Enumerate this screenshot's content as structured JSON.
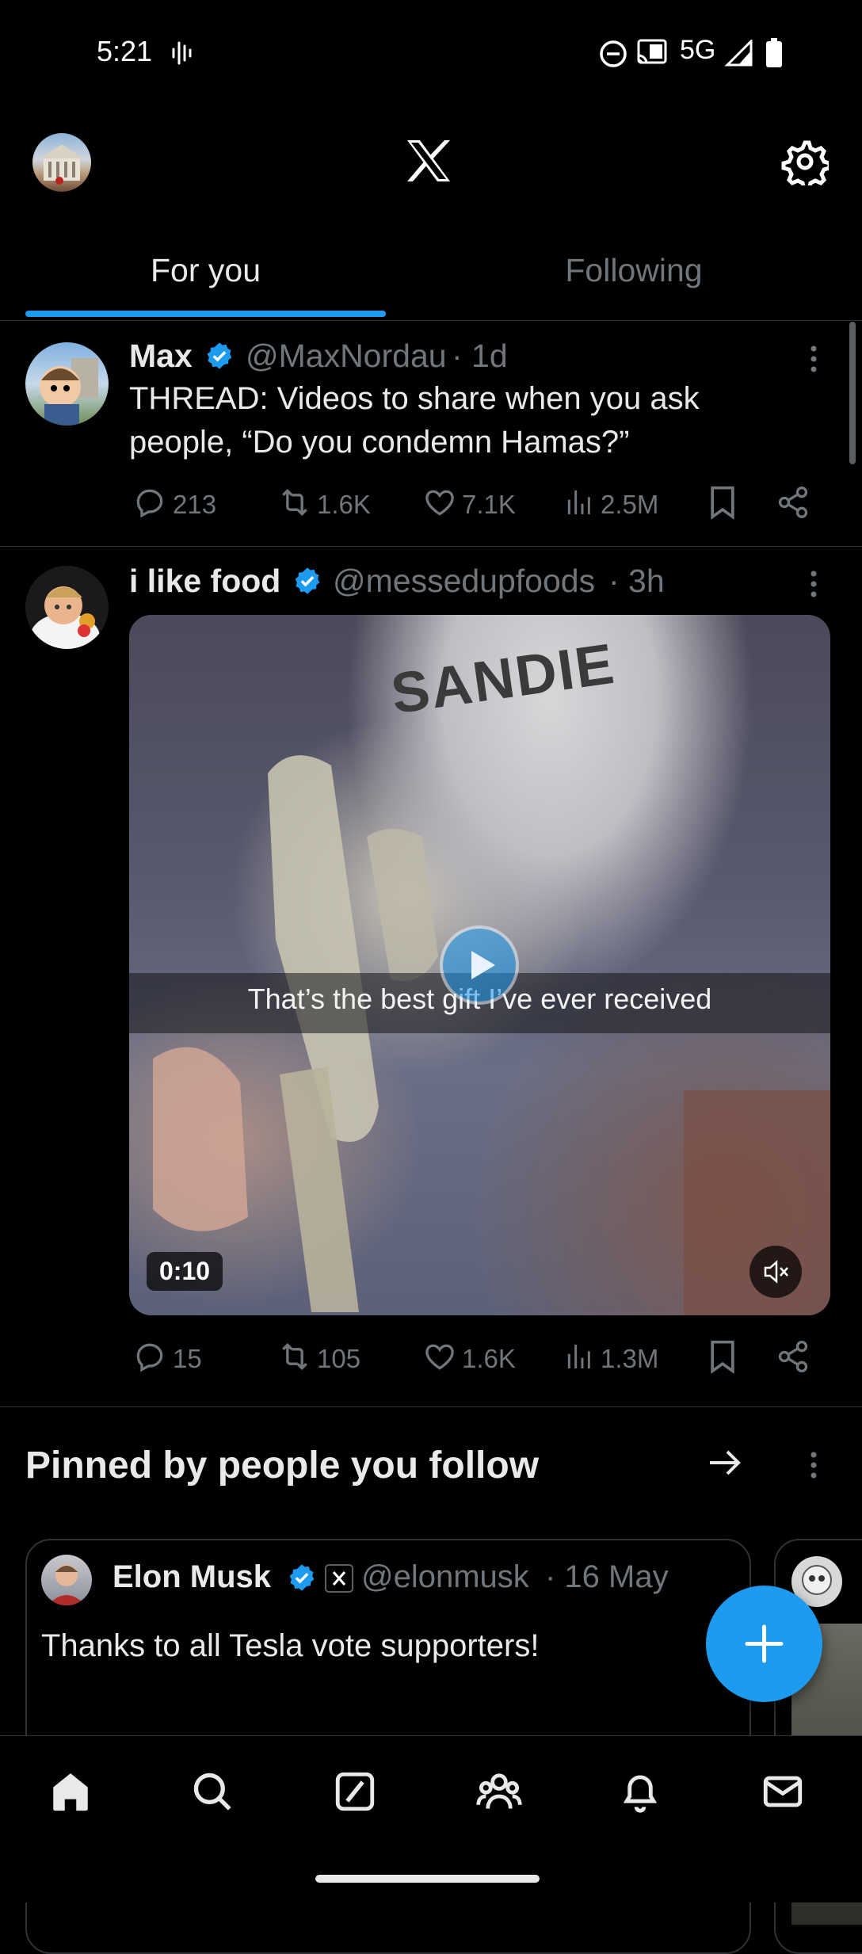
{
  "status_bar": {
    "time": "5:21",
    "network": "5G"
  },
  "header": {
    "logo_icon": "x-logo-icon",
    "settings_icon": "gear-icon"
  },
  "tabs": [
    {
      "label": "For you",
      "active": true
    },
    {
      "label": "Following",
      "active": false
    }
  ],
  "feed": [
    {
      "name": "Max",
      "handle": "@MaxNordau",
      "time": "· 1d",
      "text": "THREAD: Videos to share when you ask people, “Do you condemn Hamas?”",
      "replies": "213",
      "reposts": "1.6K",
      "likes": "7.1K",
      "views": "2.5M"
    },
    {
      "name": "i like food",
      "handle": "@messedupfoods",
      "time": "· 3h",
      "media": {
        "caption": "That’s the best gift I’ve ever received",
        "shirt_text": "SANDIE",
        "duration": "0:10"
      },
      "replies": "15",
      "reposts": "105",
      "likes": "1.6K",
      "views": "1.3M"
    }
  ],
  "pinned_section": {
    "title": "Pinned by people you follow",
    "card": {
      "name": "Elon Musk",
      "handle": "@elonmusk",
      "time": "· 16 May",
      "text": "Thanks to all Tesla vote supporters!"
    }
  },
  "colors": {
    "accent": "#1d9bf0",
    "background": "#000000",
    "text": "#e7e9ea",
    "muted": "#71767b",
    "divider": "#2f3336"
  },
  "bottom_nav": [
    "home-icon",
    "search-icon",
    "grok-icon",
    "communities-icon",
    "notifications-icon",
    "messages-icon"
  ]
}
